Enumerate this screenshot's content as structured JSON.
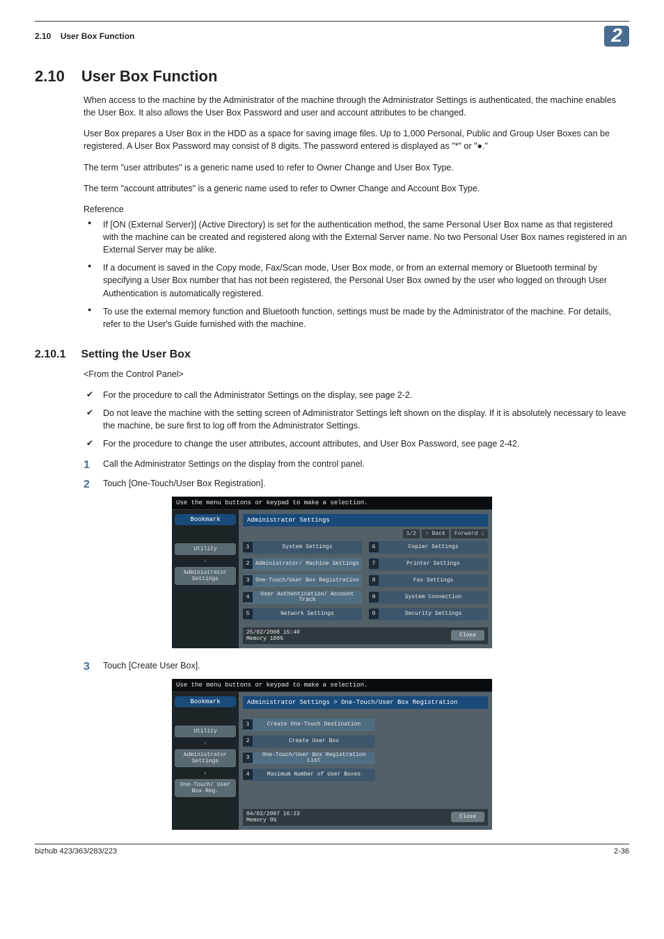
{
  "running_head": {
    "section_ref": "2.10",
    "title": "User Box Function",
    "chapter": "2"
  },
  "section": {
    "number": "2.10",
    "title": "User Box Function",
    "paras": [
      "When access to the machine by the Administrator of the machine through the Administrator Settings is authenticated, the machine enables the User Box. It also allows the User Box Password and user and account attributes to be changed.",
      "User Box prepares a User Box in the HDD as a space for saving image files. Up to 1,000 Personal, Public and Group User Boxes can be registered. A User Box Password may consist of 8 digits. The password entered is displayed as \"*\" or \"●.\"",
      "The term \"user attributes\" is a generic name used to refer to Owner Change and User Box Type.",
      "The term \"account attributes\" is a generic name used to refer to Owner Change and Account Box Type."
    ],
    "reference_label": "Reference",
    "reference_items": [
      "If [ON (External Server)] (Active Directory) is set for the authentication method, the same Personal User Box name as that registered with the machine can be created and registered along with the External Server name. No two Personal User Box names registered in an External Server may be alike.",
      "If a document is saved in the Copy mode, Fax/Scan mode, User Box mode, or from an external memory or Bluetooth terminal by specifying a User Box number that has not been registered, the Personal User Box owned by the user who logged on through User Authentication is automatically registered.",
      "To use the external memory function and Bluetooth function, settings must be made by the Administrator of the machine. For details, refer to the User's Guide furnished with the machine."
    ]
  },
  "subsection": {
    "number": "2.10.1",
    "title": "Setting the User Box",
    "angle_note": "<From the Control Panel>",
    "ticks": [
      "For the procedure to call the Administrator Settings on the display, see page 2-2.",
      "Do not leave the machine with the setting screen of Administrator Settings left shown on the display. If it is absolutely necessary to leave the machine, be sure first to log off from the Administrator Settings.",
      "For the procedure to change the user attributes, account attributes, and User Box Password, see page 2-42."
    ],
    "steps": [
      "Call the Administrator Settings on the display from the control panel.",
      "Touch [One-Touch/User Box Registration].",
      "Touch [Create User Box]."
    ]
  },
  "panel1": {
    "instruction": "Use the menu buttons or keypad to make a selection.",
    "bookmark": "Bookmark",
    "left": [
      "Utility",
      "Administrator Settings"
    ],
    "title": "Administrator Settings",
    "pager": {
      "page": "1/2",
      "back": "Back",
      "forw": "Forward"
    },
    "items": [
      {
        "n": "1",
        "t": "System Settings"
      },
      {
        "n": "6",
        "t": "Copier Settings"
      },
      {
        "n": "2",
        "t": "Administrator/\nMachine Settings"
      },
      {
        "n": "7",
        "t": "Printer Settings"
      },
      {
        "n": "3",
        "t": "One-Touch/User Box\nRegistration"
      },
      {
        "n": "8",
        "t": "Fax Settings"
      },
      {
        "n": "4",
        "t": "User Authentication/\nAccount Track"
      },
      {
        "n": "9",
        "t": "System Connection"
      },
      {
        "n": "5",
        "t": "Network Settings"
      },
      {
        "n": "0",
        "t": "Security Settings"
      }
    ],
    "footer_date": "25/02/2008   15:40",
    "footer_mem": "Memory      100%",
    "close": "Close"
  },
  "panel2": {
    "instruction": "Use the menu buttons or keypad to make a selection.",
    "bookmark": "Bookmark",
    "left": [
      "Utility",
      "Administrator Settings",
      "One-Touch/ User Box Reg."
    ],
    "title": "Administrator Settings > One-Touch/User Box Registration",
    "items": [
      {
        "n": "1",
        "t": "Create One-Touch\nDestination"
      },
      {
        "n": "2",
        "t": "Create User Box"
      },
      {
        "n": "3",
        "t": "One-Touch/User Box\nRegistration List"
      },
      {
        "n": "4",
        "t": "Maximum Number of User Boxes"
      }
    ],
    "footer_date": "04/02/2007   16:23",
    "footer_mem": "Memory       0%",
    "close": "Close"
  },
  "footer": {
    "left": "bizhub 423/363/283/223",
    "right": "2-36"
  }
}
